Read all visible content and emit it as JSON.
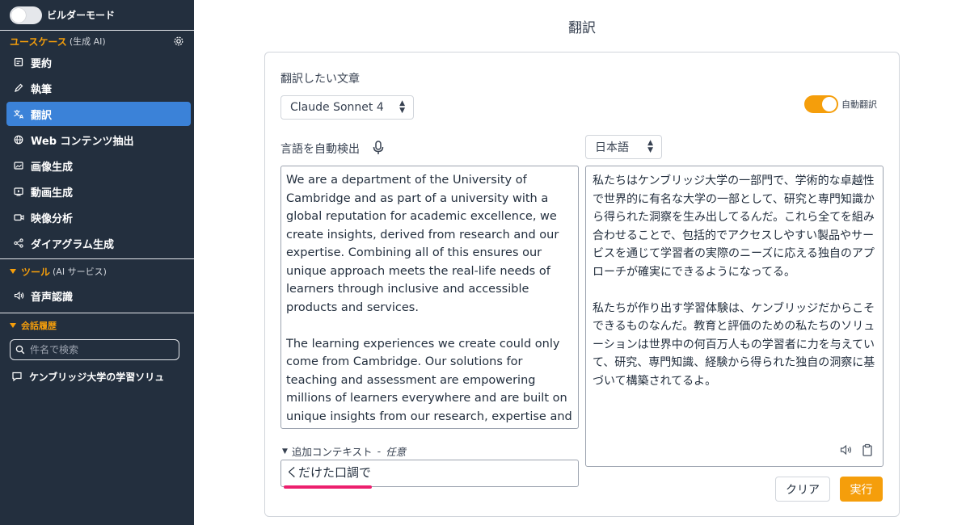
{
  "sidebar": {
    "builder_mode_label": "ビルダーモード",
    "usecase_section": {
      "title": "ユースケース",
      "subtitle": "(生成 AI)"
    },
    "usecase_items": [
      {
        "label": "要約",
        "icon": "document-icon"
      },
      {
        "label": "執筆",
        "icon": "pen-icon"
      },
      {
        "label": "翻訳",
        "icon": "translate-icon",
        "active": true
      },
      {
        "label": "Web コンテンツ抽出",
        "icon": "globe-icon"
      },
      {
        "label": "画像生成",
        "icon": "image-icon"
      },
      {
        "label": "動画生成",
        "icon": "video-frame-icon"
      },
      {
        "label": "映像分析",
        "icon": "camera-icon"
      },
      {
        "label": "ダイアグラム生成",
        "icon": "diagram-icon"
      }
    ],
    "tools_section": {
      "title": "ツール",
      "subtitle": "(AI サービス)"
    },
    "tools_items": [
      {
        "label": "音声認識",
        "icon": "speaker-icon"
      }
    ],
    "history_section": {
      "title": "会話履歴"
    },
    "search": {
      "placeholder": "件名で検索",
      "value": ""
    },
    "history_items": [
      {
        "label": "ケンブリッジ大学の学習ソリュ"
      }
    ]
  },
  "main": {
    "page_title": "翻訳",
    "source_label": "翻訳したい文章",
    "model_select": {
      "value": "Claude Sonnet 4"
    },
    "auto_translate": {
      "label": "自動翻訳",
      "enabled": true
    },
    "source_language_label": "言語を自動検出",
    "target_language_select": {
      "value": "日本語"
    },
    "source_text": "We are a department of the University of Cambridge and as part of a university with a global reputation for academic excellence, we create insights, derived from research and our expertise. Combining all of this ensures our unique approach meets the real-life needs of learners through inclusive and accessible products and services.\n\nThe learning experiences we create could only come from Cambridge. Our solutions for teaching and assessment are empowering millions of learners everywhere and are built on unique insights from our research, expertise and experience.",
    "translated_text": "私たちはケンブリッジ大学の一部門で、学術的な卓越性で世界的に有名な大学の一部として、研究と専門知識から得られた洞察を生み出してるんだ。これら全てを組み合わせることで、包括的でアクセスしやすい製品やサービスを通じて学習者の実際のニーズに応える独自のアプローチが確実にできるようになってる。\n\n私たちが作り出す学習体験は、ケンブリッジだからこそできるものなんだ。教育と評価のための私たちのソリューションは世界中の何百万人もの学習者に力を与えていて、研究、専門知識、経験から得られた独自の洞察に基づいて構築されてるよ。",
    "additional_context": {
      "label": "追加コンテキスト",
      "separator": "-",
      "optional": "任意",
      "value": "くだけた口調で"
    },
    "clear_button": "クリア",
    "run_button": "実行"
  },
  "colors": {
    "sidebar_bg": "#232f3e",
    "accent": "#f59e0b",
    "active_item": "#3b82d8",
    "highlight": "#ec1f6d"
  }
}
